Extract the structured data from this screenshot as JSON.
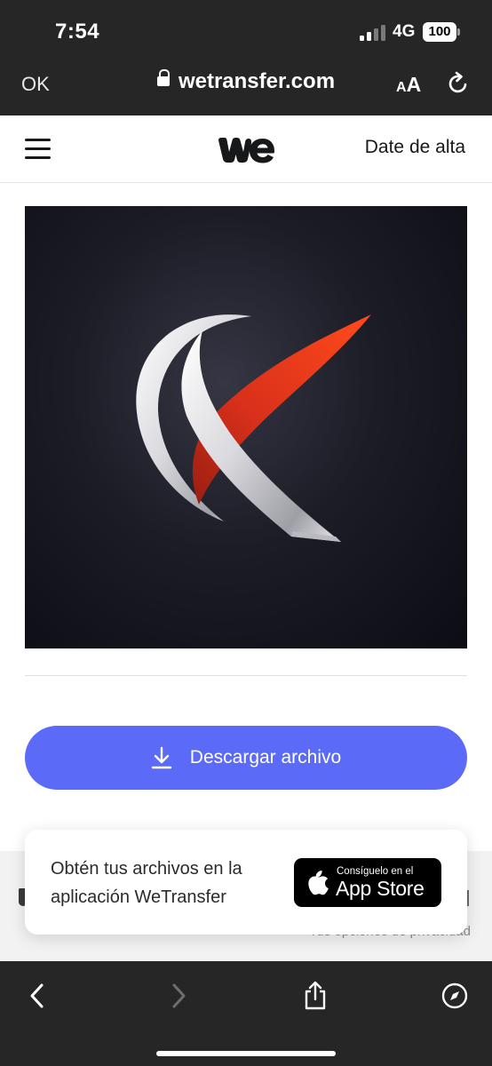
{
  "status_bar": {
    "time": "7:54",
    "network": "4G",
    "battery": "100"
  },
  "safari": {
    "done_label": "OK",
    "url": "wetransfer.com",
    "text_size_small": "A",
    "text_size_large": "A"
  },
  "header": {
    "signup_label": "Date de alta"
  },
  "main": {
    "download_label": "Descargar archivo"
  },
  "promo": {
    "text": "Obtén tus archivos en la aplicación WeTransfer",
    "store_small": "Consíguelo en el",
    "store_big": "App Store"
  },
  "background": {
    "privacy_text": "Tus opciones de privacidad"
  },
  "colors": {
    "accent": "#5c6bf7",
    "safari_bar": "#262626",
    "logo_red": "#e8381c"
  }
}
